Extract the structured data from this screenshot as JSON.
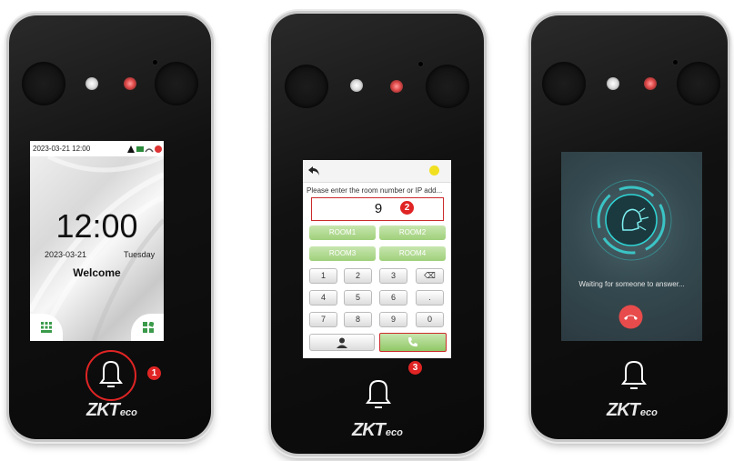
{
  "panel1": {
    "status_datetime": "2023-03-21 12:00",
    "clock": "12:00",
    "date": "2023-03-21",
    "weekday": "Tuesday",
    "welcome": "Welcome",
    "brand": "ZKTeco",
    "badge": "1"
  },
  "panel2": {
    "prompt": "Please enter the room number or IP add...",
    "input_value": "9",
    "rooms": [
      "ROOM1",
      "ROOM2",
      "ROOM3",
      "ROOM4"
    ],
    "keys": [
      "1",
      "2",
      "3",
      "⌫",
      "4",
      "5",
      "6",
      ".",
      "7",
      "8",
      "9",
      "0"
    ],
    "brand": "ZKTeco",
    "input_badge": "2",
    "call_badge": "3"
  },
  "panel3": {
    "waiting_text": "Waiting for someone to answer...",
    "brand": "ZKTeco"
  },
  "colors": {
    "highlight_red": "#cc2b2b",
    "room_green": "#9fd07a",
    "hangup_red": "#e84b4b",
    "call_teal": "#2fd6d6"
  }
}
